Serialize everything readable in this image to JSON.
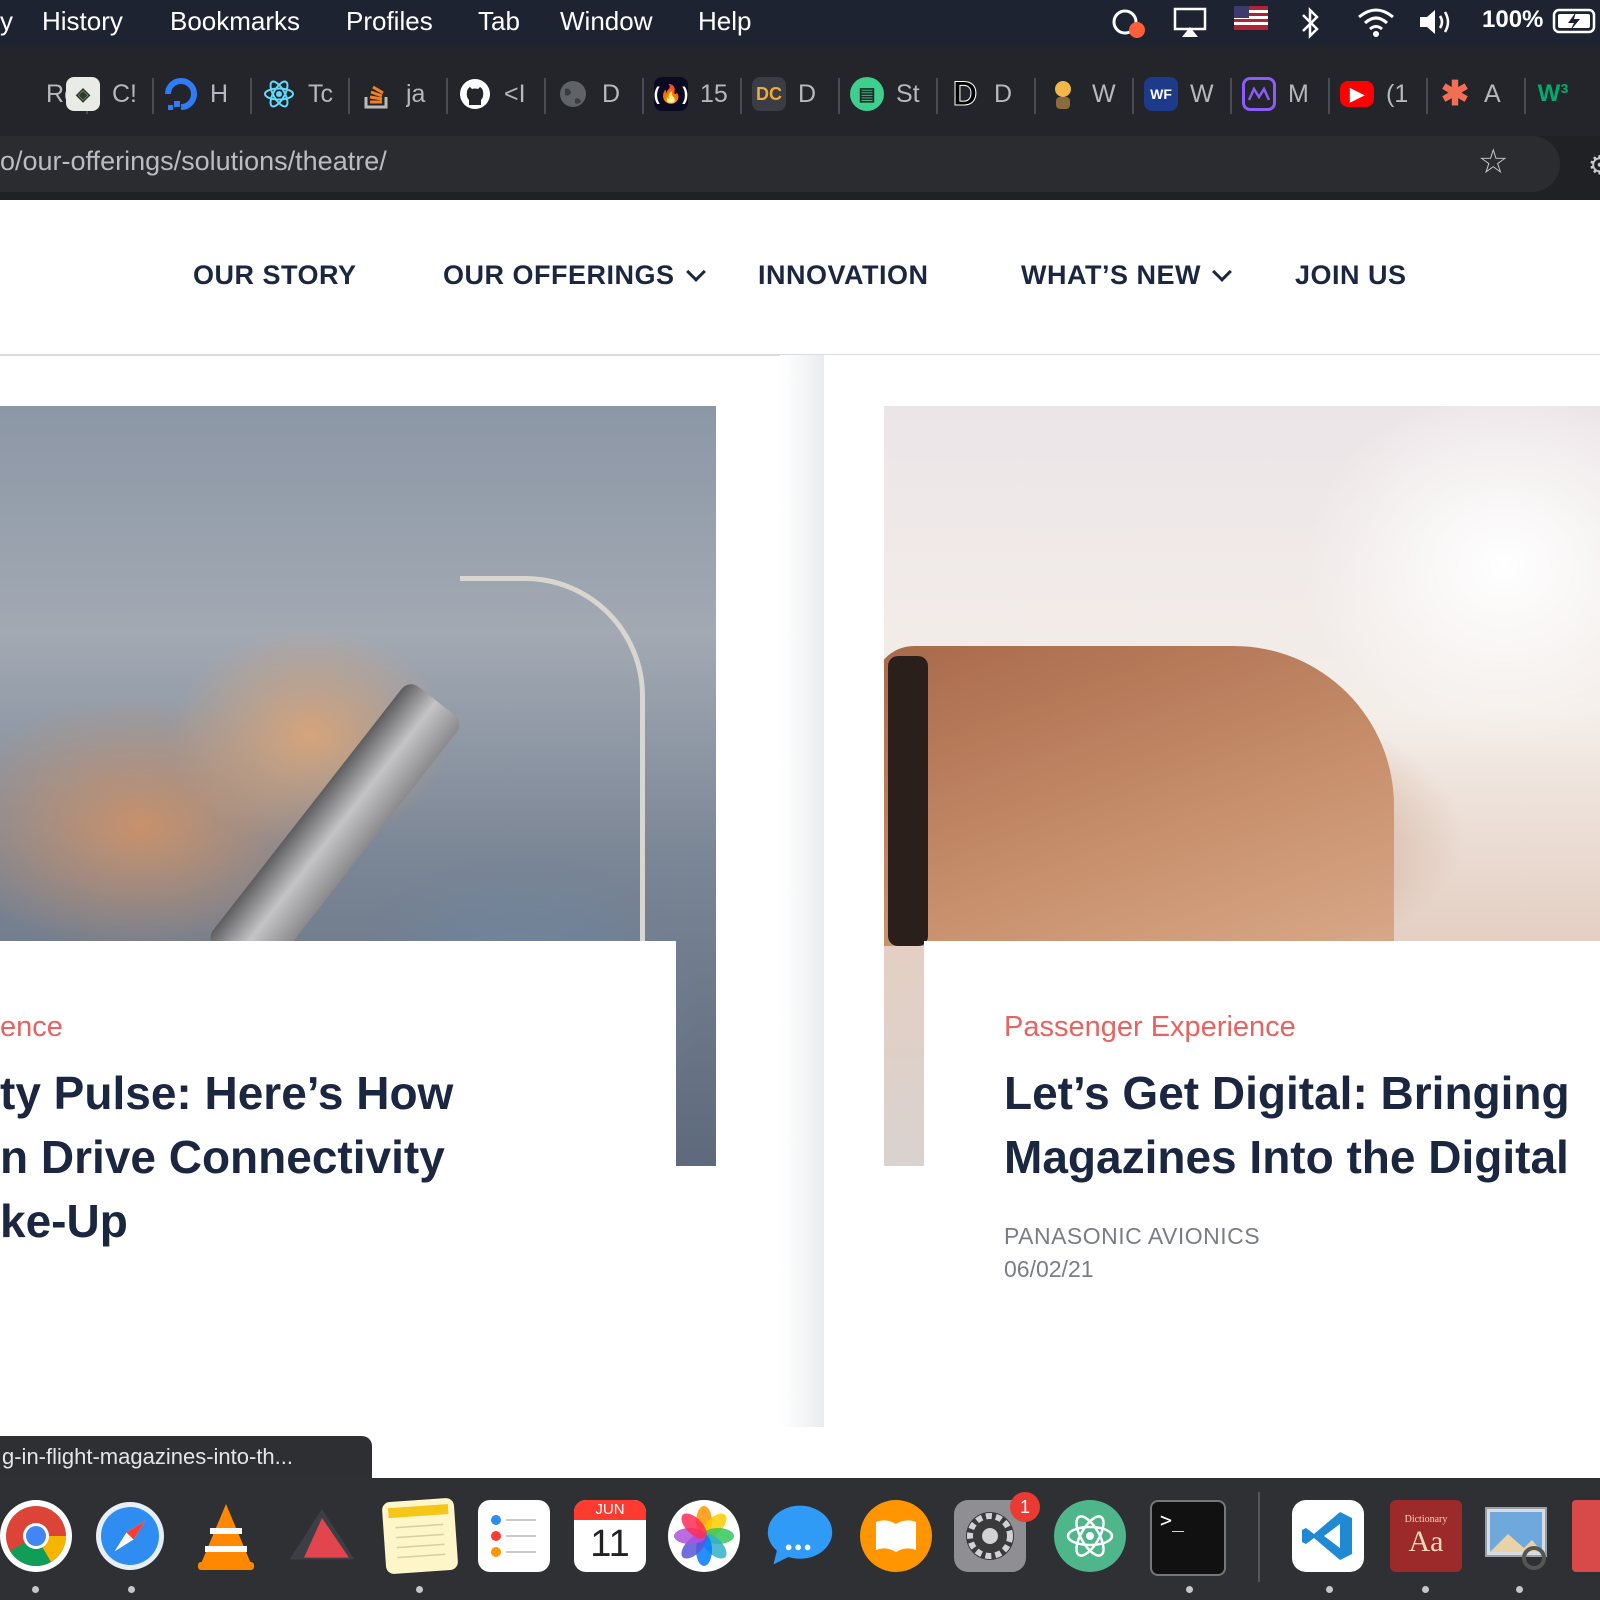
{
  "menubar": {
    "items": [
      "History",
      "Bookmarks",
      "Profiles",
      "Tab",
      "Window",
      "Help"
    ],
    "battery": "100%"
  },
  "tabs": [
    {
      "label": "Rc",
      "icon": "rc-icon"
    },
    {
      "label": "C!",
      "icon": "cs-icon"
    },
    {
      "label": "H",
      "icon": "digitalocean-icon"
    },
    {
      "label": "Tc",
      "icon": "react-icon"
    },
    {
      "label": "ja",
      "icon": "stackoverflow-icon"
    },
    {
      "label": "<I",
      "icon": "github-icon"
    },
    {
      "label": "D",
      "icon": "globe-icon"
    },
    {
      "label": "15",
      "icon": "freecodecamp-icon"
    },
    {
      "label": "D",
      "icon": "dc-icon"
    },
    {
      "label": "St",
      "icon": "st-icon"
    },
    {
      "label": "D",
      "icon": "d-icon"
    },
    {
      "label": "W",
      "icon": "avatar-icon"
    },
    {
      "label": "W",
      "icon": "wf-icon"
    },
    {
      "label": "M",
      "icon": "m-icon"
    },
    {
      "label": "(1",
      "icon": "youtube-icon"
    },
    {
      "label": "A",
      "icon": "asterisk-icon"
    },
    {
      "label": "",
      "icon": "w3-icon"
    }
  ],
  "url": "o/our-offerings/solutions/theatre/",
  "nav": {
    "items": [
      {
        "label": "OUR STORY",
        "dropdown": false
      },
      {
        "label": "OUR OFFERINGS",
        "dropdown": true
      },
      {
        "label": "INNOVATION",
        "dropdown": false
      },
      {
        "label": "WHAT’S NEW",
        "dropdown": true
      },
      {
        "label": "JOIN US",
        "dropdown": false
      }
    ]
  },
  "cards": [
    {
      "category": "ence",
      "lines": [
        "ty Pulse: Here’s How",
        "n Drive Connectivity",
        "ke-Up"
      ]
    },
    {
      "category": "Passenger Experience",
      "lines": [
        "Let’s Get Digital: Bringing",
        "Magazines Into the Digital"
      ],
      "author": "PANASONIC AVIONICS",
      "date": "06/02/21"
    }
  ],
  "status_url": "g-in-flight-magazines-into-th...",
  "dock": {
    "calendar_month": "JUN",
    "calendar_day": "11",
    "system_prefs_badge": "1",
    "terminal_prompt": ">_",
    "dictionary_label": "Aa",
    "dictionary_title": "Dictionary"
  }
}
